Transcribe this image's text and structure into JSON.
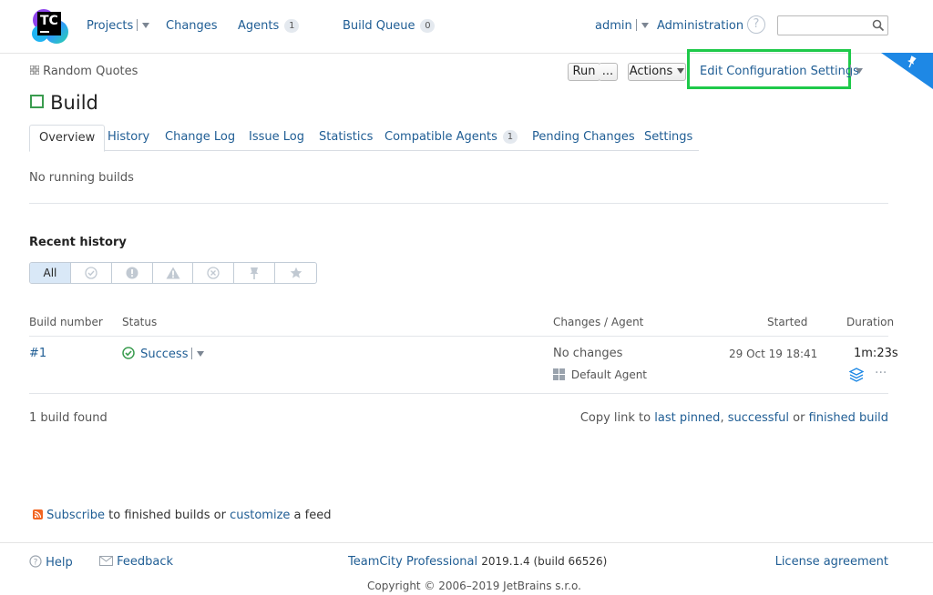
{
  "header": {
    "logo_text": "TC",
    "nav": {
      "projects": "Projects",
      "changes": "Changes",
      "agents": "Agents",
      "agents_count": "1",
      "build_queue": "Build Queue",
      "build_queue_count": "0"
    },
    "user": "admin",
    "administration": "Administration",
    "help_glyph": "?",
    "search_placeholder": ""
  },
  "breadcrumb": {
    "project": "Random Quotes"
  },
  "toolbar": {
    "run_label": "Run",
    "run_more_label": "...",
    "actions_label": "Actions",
    "edit_settings_label": "Edit Configuration Settings"
  },
  "page": {
    "title": "Build"
  },
  "tabs": [
    {
      "label": "Overview",
      "active": true
    },
    {
      "label": "History"
    },
    {
      "label": "Change Log"
    },
    {
      "label": "Issue Log"
    },
    {
      "label": "Statistics"
    },
    {
      "label": "Compatible Agents",
      "badge": "1"
    },
    {
      "label": "Pending Changes"
    },
    {
      "label": "Settings"
    }
  ],
  "overview": {
    "running_text": "No running builds",
    "recent_history_title": "Recent history",
    "filter_all_label": "All",
    "filters": [
      "success-filter-icon",
      "failed-filter-icon",
      "warning-filter-icon",
      "cancelled-filter-icon",
      "pinned-filter-icon",
      "starred-filter-icon"
    ]
  },
  "table": {
    "headers": {
      "build_number": "Build number",
      "status": "Status",
      "changes_agent": "Changes / Agent",
      "started": "Started",
      "duration": "Duration"
    },
    "rows": [
      {
        "number": "#1",
        "status": "Success",
        "changes": "No changes",
        "agent": "Default Agent",
        "started": "29 Oct 19 18:41",
        "duration": "1m:23s"
      }
    ]
  },
  "summary": {
    "found": "1 build found",
    "copy_prefix": "Copy link to",
    "last_pinned": "last pinned",
    "comma": ",",
    "successful": "successful",
    "or": "or",
    "finished_build": "finished build"
  },
  "feed": {
    "subscribe": "Subscribe",
    "middle": "to finished builds or",
    "customize": "customize",
    "suffix": "a feed"
  },
  "footer": {
    "help": "Help",
    "feedback": "Feedback",
    "product": "TeamCity Professional",
    "version": "2019.1.4 (build 66526)",
    "license": "License agreement",
    "copyright": "Copyright © 2006–2019 JetBrains s.r.o."
  },
  "colors": {
    "link": "#1f5d94",
    "success": "#3a9c4f",
    "highlight": "#1ec94a",
    "corner": "#1e88e5"
  }
}
